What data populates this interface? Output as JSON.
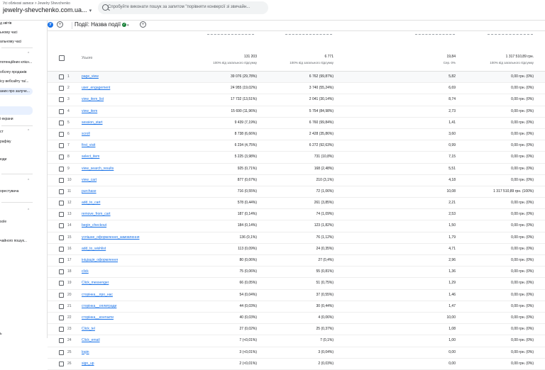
{
  "header": {
    "breadcrumb": "Усі облікові записи > Jewelry Shevchenko",
    "property_name": "jewelry-shevchenko.com.ua...",
    "search_placeholder": "Спробуйте виконати пошук за запитом \"порівняти конверсії зі звичайн..."
  },
  "sidebar": {
    "items": [
      "д звітів",
      "ьному часі",
      "альному часі",
      "потенційних клієн...",
      "обсягу продажів",
      "ісу вебсайту та/...",
      "аних про залуче...",
      "і екрани",
      "ст",
      "рафіку",
      "юди",
      "орестувача",
      "sole",
      "чайного пошук...",
      "ь"
    ]
  },
  "filterbar": {
    "badge": "У",
    "dimension_label": "Події: Назва події"
  },
  "table": {
    "header": {
      "label": "Усього",
      "totals": [
        {
          "value": "131 203",
          "sub": "100% від загального підсумку"
        },
        {
          "value": "6 771",
          "sub": "100% від загального підсумку"
        },
        {
          "value": "19,84",
          "sub": "Сер. 0%"
        },
        {
          "value": "1 317 510,89 грн.",
          "sub": "100% від загального підсумку"
        }
      ]
    },
    "rows": [
      {
        "i": "1",
        "event": "page_view",
        "c1": "39 076 (29,78%)",
        "c2": "6 762 (99,87%)",
        "c3": "5,82",
        "c4": "0,00 грн. (0%)"
      },
      {
        "i": "2",
        "event": "user_engagement",
        "c1": "24 955 (19,02%)",
        "c2": "3 740 (55,24%)",
        "c3": "6,69",
        "c4": "0,00 грн. (0%)"
      },
      {
        "i": "3",
        "event": "view_item_list",
        "c1": "17 732 (13,51%)",
        "c2": "2 041 (30,14%)",
        "c3": "8,74",
        "c4": "0,00 грн. (0%)"
      },
      {
        "i": "4",
        "event": "view_item",
        "c1": "15 690 (11,96%)",
        "c2": "5 754 (84,98%)",
        "c3": "2,73",
        "c4": "0,00 грн. (0%)"
      },
      {
        "i": "5",
        "event": "session_start",
        "c1": "9 439 (7,19%)",
        "c2": "6 760 (99,84%)",
        "c3": "1,41",
        "c4": "0,00 грн. (0%)"
      },
      {
        "i": "6",
        "event": "scroll",
        "c1": "8 738 (6,66%)",
        "c2": "2 428 (35,86%)",
        "c3": "3,60",
        "c4": "0,00 грн. (0%)"
      },
      {
        "i": "7",
        "event": "first_visit",
        "c1": "6 234 (4,75%)",
        "c2": "6 272 (92,63%)",
        "c3": "0,99",
        "c4": "0,00 грн. (0%)"
      },
      {
        "i": "8",
        "event": "select_item",
        "c1": "5 225 (3,98%)",
        "c2": "731 (10,8%)",
        "c3": "7,15",
        "c4": "0,00 грн. (0%)"
      },
      {
        "i": "9",
        "event": "view_search_results",
        "c1": "925 (0,71%)",
        "c2": "168 (2,48%)",
        "c3": "5,51",
        "c4": "0,00 грн. (0%)"
      },
      {
        "i": "10",
        "event": "view_cart",
        "c1": "877 (0,67%)",
        "c2": "210 (3,1%)",
        "c3": "4,18",
        "c4": "0,00 грн. (0%)"
      },
      {
        "i": "11",
        "event": "purchase",
        "c1": "716 (0,55%)",
        "c2": "72 (1,06%)",
        "c3": "10,08",
        "c4": "1 317 510,89 грн. (100%)"
      },
      {
        "i": "12",
        "event": "add_to_cart",
        "c1": "578 (0,44%)",
        "c2": "261 (3,85%)",
        "c3": "2,21",
        "c4": "0,00 грн. (0%)"
      },
      {
        "i": "13",
        "event": "remove_from_cart",
        "c1": "187 (0,14%)",
        "c2": "74 (1,09%)",
        "c3": "2,53",
        "c4": "0,00 грн. (0%)"
      },
      {
        "i": "14",
        "event": "begin_checkout",
        "c1": "184 (0,14%)",
        "c2": "123 (1,82%)",
        "c3": "1,50",
        "c4": "0,00 грн. (0%)"
      },
      {
        "i": "15",
        "event": "успішне_оформлення_замовлення",
        "c1": "136 (0,1%)",
        "c2": "76 (1,12%)",
        "c3": "1,79",
        "c4": "0,00 грн. (0%)"
      },
      {
        "i": "16",
        "event": "add_to_wishlist",
        "c1": "113 (0,09%)",
        "c2": "24 (0,35%)",
        "c3": "4,71",
        "c4": "0,00 грн. (0%)"
      },
      {
        "i": "17",
        "event": "ініціація_оформлення",
        "c1": "80 (0,06%)",
        "c2": "27 (0,4%)",
        "c3": "2,96",
        "c4": "0,00 грн. (0%)"
      },
      {
        "i": "18",
        "event": "click",
        "c1": "75 (0,06%)",
        "c2": "55 (0,81%)",
        "c3": "1,36",
        "c4": "0,00 грн. (0%)"
      },
      {
        "i": "19",
        "event": "Click_messenger",
        "c1": "66 (0,05%)",
        "c2": "51 (0,75%)",
        "c3": "1,29",
        "c4": "0,00 грн. (0%)"
      },
      {
        "i": "20",
        "event": "сторінка__про_нас",
        "c1": "54 (0,04%)",
        "c2": "37 (0,55%)",
        "c3": "1,46",
        "c4": "0,00 грн. (0%)"
      },
      {
        "i": "21",
        "event": "сторінка__оплвтради",
        "c1": "44 (0,03%)",
        "c2": "30 (0,44%)",
        "c3": "1,47",
        "c4": "0,00 грн. (0%)"
      },
      {
        "i": "22",
        "event": "сторінка__контакти",
        "c1": "40 (0,03%)",
        "c2": "4 (0,06%)",
        "c3": "10,00",
        "c4": "0,00 грн. (0%)"
      },
      {
        "i": "23",
        "event": "Click_tel",
        "c1": "27 (0,02%)",
        "c2": "25 (0,37%)",
        "c3": "1,08",
        "c4": "0,00 грн. (0%)"
      },
      {
        "i": "24",
        "event": "Click_email",
        "c1": "7 (<0,01%)",
        "c2": "7 (0,1%)",
        "c3": "1,00",
        "c4": "0,00 грн. (0%)"
      },
      {
        "i": "25",
        "event": "login",
        "c1": "3 (<0,01%)",
        "c2": "3 (0,04%)",
        "c3": "0,00",
        "c4": "0,00 грн. (0%)"
      },
      {
        "i": "26",
        "event": "sign_up",
        "c1": "2 (<0,01%)",
        "c2": "2 (0,03%)",
        "c3": "0,00",
        "c4": "0,00 грн. (0%)"
      }
    ]
  }
}
